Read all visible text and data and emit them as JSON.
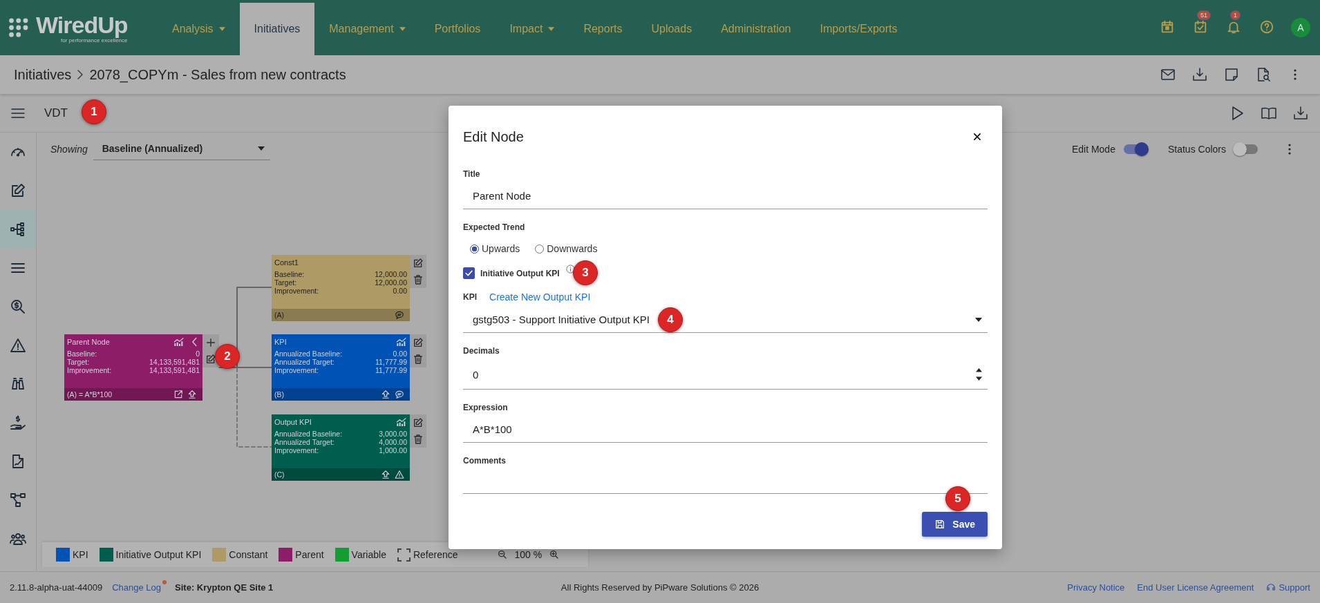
{
  "nav": {
    "logo": "WiredUp",
    "tagline": "for performance excellence",
    "items": [
      {
        "label": "Analysis",
        "dropdown": true,
        "selected": false
      },
      {
        "label": "Initiatives",
        "dropdown": false,
        "selected": true
      },
      {
        "label": "Management",
        "dropdown": true,
        "selected": false
      },
      {
        "label": "Portfolios",
        "dropdown": false,
        "selected": false
      },
      {
        "label": "Impact",
        "dropdown": true,
        "selected": false
      },
      {
        "label": "Reports",
        "dropdown": false,
        "selected": false
      },
      {
        "label": "Uploads",
        "dropdown": false,
        "selected": false
      },
      {
        "label": "Administration",
        "dropdown": false,
        "selected": false
      },
      {
        "label": "Imports/Exports",
        "dropdown": false,
        "selected": false
      }
    ],
    "tasks_badge": "51",
    "notifications_badge": "1",
    "avatar": "A"
  },
  "breadcrumb": [
    "Initiatives",
    "2078_COPYm - Sales from new contracts"
  ],
  "toolbar": {
    "title": "VDT"
  },
  "sidebar": {
    "items": [
      {
        "selected": false
      },
      {
        "selected": false
      },
      {
        "selected": true
      },
      {
        "selected": false
      },
      {
        "selected": false
      },
      {
        "selected": false
      },
      {
        "selected": false
      },
      {
        "selected": false
      },
      {
        "selected": false
      },
      {
        "selected": false
      },
      {
        "selected": false
      }
    ]
  },
  "canvas": {
    "showing_label": "Showing",
    "showing_value": "Baseline (Annualized)",
    "edit_mode": {
      "label": "Edit Mode",
      "on": true
    },
    "status_colors": {
      "label": "Status Colors",
      "on": false
    },
    "nodes": [
      {
        "kind": "parent",
        "color": "#8e1d68",
        "title": "Parent Node",
        "rows": [
          {
            "label": "Baseline:",
            "value": "0"
          },
          {
            "label": "Target:",
            "value": "14,133,591,481"
          },
          {
            "label": "Improvement:",
            "value": "14,133,591,481"
          }
        ],
        "footer": "(A) = A*B*100"
      },
      {
        "kind": "constant",
        "color": "#ae9a64",
        "title": "Const1",
        "rows": [
          {
            "label": "Baseline:",
            "value": "12,000.00"
          },
          {
            "label": "Target:",
            "value": "12,000.00"
          },
          {
            "label": "Improvement:",
            "value": "0.00"
          }
        ],
        "footer": "(A)"
      },
      {
        "kind": "kpi",
        "color": "#0052b4",
        "title": "KPI",
        "rows": [
          {
            "label": "Annualized Baseline:",
            "value": "0.00"
          },
          {
            "label": "Annualized Target:",
            "value": "11,777.99"
          },
          {
            "label": "Improvement:",
            "value": "11,777.99"
          }
        ],
        "footer": "(B)"
      },
      {
        "kind": "output",
        "color": "#005e4e",
        "title": "Output KPI",
        "rows": [
          {
            "label": "Annualized Baseline:",
            "value": "3,000.00"
          },
          {
            "label": "Annualized Target:",
            "value": "4,000.00"
          },
          {
            "label": "Improvement:",
            "value": "1,000.00"
          }
        ],
        "footer": "(C)"
      }
    ],
    "legend": [
      {
        "kind": "swatch",
        "label": "KPI",
        "color": "#0052b4"
      },
      {
        "kind": "swatch",
        "label": "Initiative Output KPI",
        "color": "#005e4e"
      },
      {
        "kind": "swatch",
        "label": "Constant",
        "color": "#ae9a64"
      },
      {
        "kind": "swatch",
        "label": "Parent",
        "color": "#8e1d68"
      },
      {
        "kind": "swatch",
        "label": "Variable",
        "color": "#129e30"
      },
      {
        "kind": "dashed",
        "label": "Reference"
      }
    ],
    "zoom": "100 %"
  },
  "dialog": {
    "title": "Edit Node",
    "title_label": "Title",
    "title_value": "Parent Node",
    "trend_label": "Expected Trend",
    "trend_options": [
      {
        "label": "Upwards",
        "selected": true
      },
      {
        "label": "Downwards",
        "selected": false
      }
    ],
    "output_kpi": {
      "label": "Initiative Output KPI",
      "checked": true
    },
    "kpi_label": "KPI",
    "kpi_link": "Create New Output KPI",
    "kpi_value": "gstg503 - Support Initiative Output KPI",
    "decimals_label": "Decimals",
    "decimals_value": "0",
    "expression_label": "Expression",
    "expression_value": "A*B*100",
    "comments_label": "Comments",
    "save": "Save"
  },
  "markers": [
    "1",
    "2",
    "3",
    "4",
    "5"
  ],
  "footer": {
    "version": "2.11.8-alpha-uat-44009",
    "change_log": "Change Log",
    "site": "Site: Krypton QE Site 1",
    "copyright": "All Rights Reserved by PiPware Solutions © 2026",
    "links": [
      "Privacy Notice",
      "End User License Agreement"
    ],
    "support": "Support"
  }
}
